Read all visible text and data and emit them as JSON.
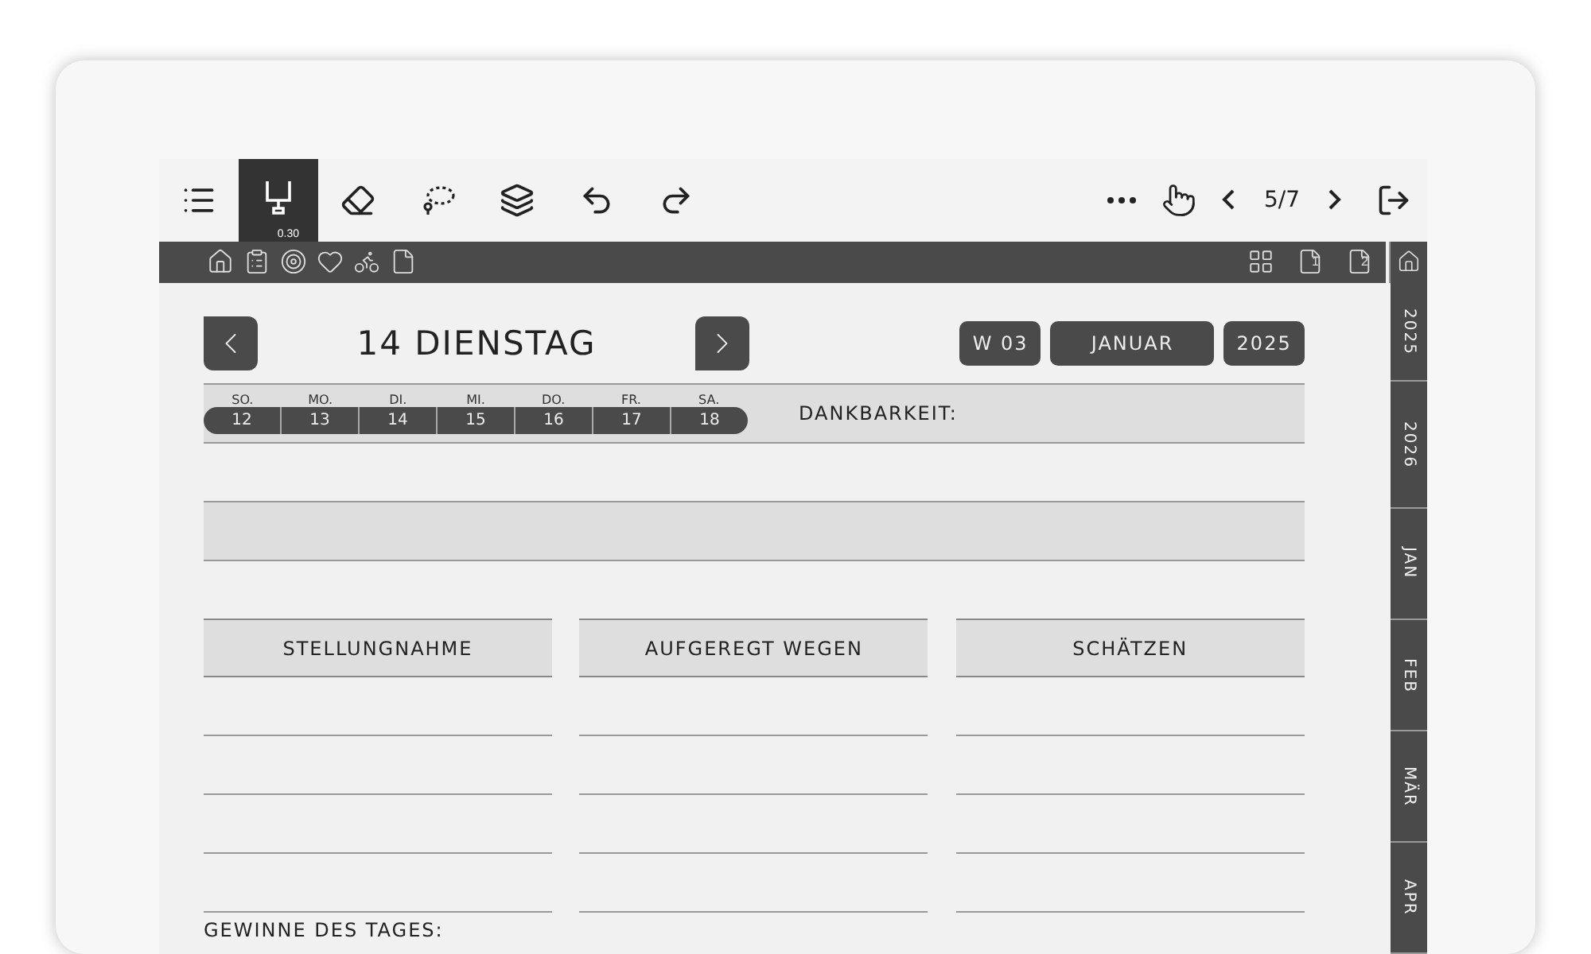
{
  "toolbar": {
    "tools": [
      {
        "kind": "menu",
        "selected": false
      },
      {
        "kind": "pen",
        "selected": true,
        "size": "0.30"
      },
      {
        "kind": "eraser",
        "selected": false
      },
      {
        "kind": "lasso",
        "selected": false
      },
      {
        "kind": "layers",
        "selected": false
      },
      {
        "kind": "undo",
        "selected": false
      },
      {
        "kind": "redo",
        "selected": false
      }
    ],
    "page": "5/7"
  },
  "nav": {
    "icons": [
      {
        "kind": "home"
      },
      {
        "kind": "clipboard"
      },
      {
        "kind": "target"
      },
      {
        "kind": "heart"
      },
      {
        "kind": "bike"
      },
      {
        "kind": "page"
      }
    ],
    "right_icons": [
      {
        "kind": "grid"
      },
      {
        "kind": "day",
        "badge": "1"
      },
      {
        "kind": "day",
        "badge": "2"
      }
    ]
  },
  "day": {
    "title": "14 DIENSTAG",
    "badges": [
      "W 03",
      "JANUAR",
      "2025"
    ]
  },
  "week": [
    {
      "dow": "SO.",
      "date": "12"
    },
    {
      "dow": "MO.",
      "date": "13"
    },
    {
      "dow": "DI.",
      "date": "14"
    },
    {
      "dow": "MI.",
      "date": "15"
    },
    {
      "dow": "DO.",
      "date": "16"
    },
    {
      "dow": "FR.",
      "date": "17"
    },
    {
      "dow": "SA.",
      "date": "18"
    }
  ],
  "gratitude_label": "DANKBARKEIT:",
  "columns": [
    {
      "header": "STELLUNGNAHME"
    },
    {
      "header": "AUFGEREGT WEGEN"
    },
    {
      "header": "SCHÄTZEN"
    }
  ],
  "wins_label": "GEWINNE DES TAGES:",
  "side_tabs": [
    {
      "label": "2025"
    },
    {
      "label": "2026"
    },
    {
      "label": "JAN"
    },
    {
      "label": "FEB"
    },
    {
      "label": "MÄR"
    },
    {
      "label": "APR"
    }
  ]
}
